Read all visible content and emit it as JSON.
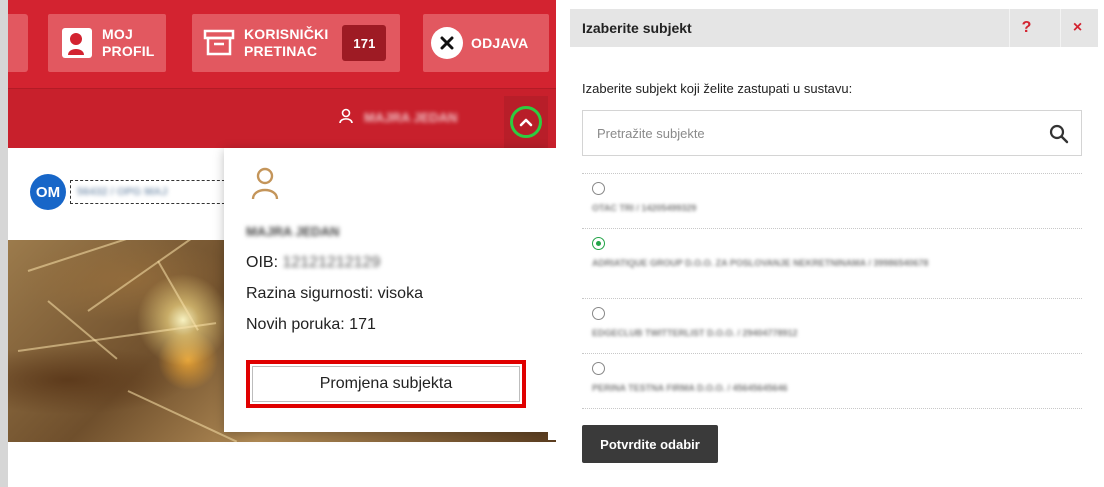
{
  "left_panel": {
    "topbar": {
      "profile_label_line1": "MOJ",
      "profile_label_line2": "PROFIL",
      "inbox_label_line1": "KORISNIČKI",
      "inbox_label_line2": "PRETINAC",
      "inbox_count": "171",
      "logout_label": "ODJAVA"
    },
    "user_bar": {
      "user_name": "MAJRA JEDAN"
    },
    "org_selector": {
      "badge": "OM",
      "value": "56432 / OPG MAJ"
    },
    "dropdown_card": {
      "name": "MAJRA JEDAN",
      "oib_label": "OIB:",
      "oib_value": "12121212129",
      "security_level": "Razina sigurnosti: visoka",
      "new_messages": "Novih poruka: 171",
      "change_subject_button": "Promjena subjekta"
    }
  },
  "modal": {
    "title": "Izaberite subjekt",
    "help_label": "?",
    "close_label": "×",
    "prompt": "Izaberite subjekt koji želite zastupati u sustavu:",
    "search_placeholder": "Pretražite subjekte",
    "subjects": [
      {
        "text": "OTAC TRI / 14205499329",
        "selected": false
      },
      {
        "text": "ADRIATIQUE GROUP D.O.O. ZA POSLOVANJE NEKRETNINAMA / 39986540678",
        "selected": true
      },
      {
        "text": "EDGECLUB TWITTERLIST D.O.O. / 29404778912",
        "selected": false
      },
      {
        "text": "PERINA TESTNA FIRMA D.O.O. / 45645645646",
        "selected": false
      }
    ],
    "confirm_button": "Potvrdite odabir"
  },
  "colors": {
    "brand_red": "#d32330",
    "highlight_frame": "#e00000",
    "chevron_ring": "#2ecc40",
    "selected_radio": "#22a447",
    "badge_blue": "#1766c8"
  },
  "icons": [
    "profile-icon",
    "inbox-icon",
    "close-x-icon",
    "user-icon",
    "chevron-up-icon",
    "search-icon",
    "help-icon",
    "close-icon",
    "org-chevron-down-icon"
  ]
}
